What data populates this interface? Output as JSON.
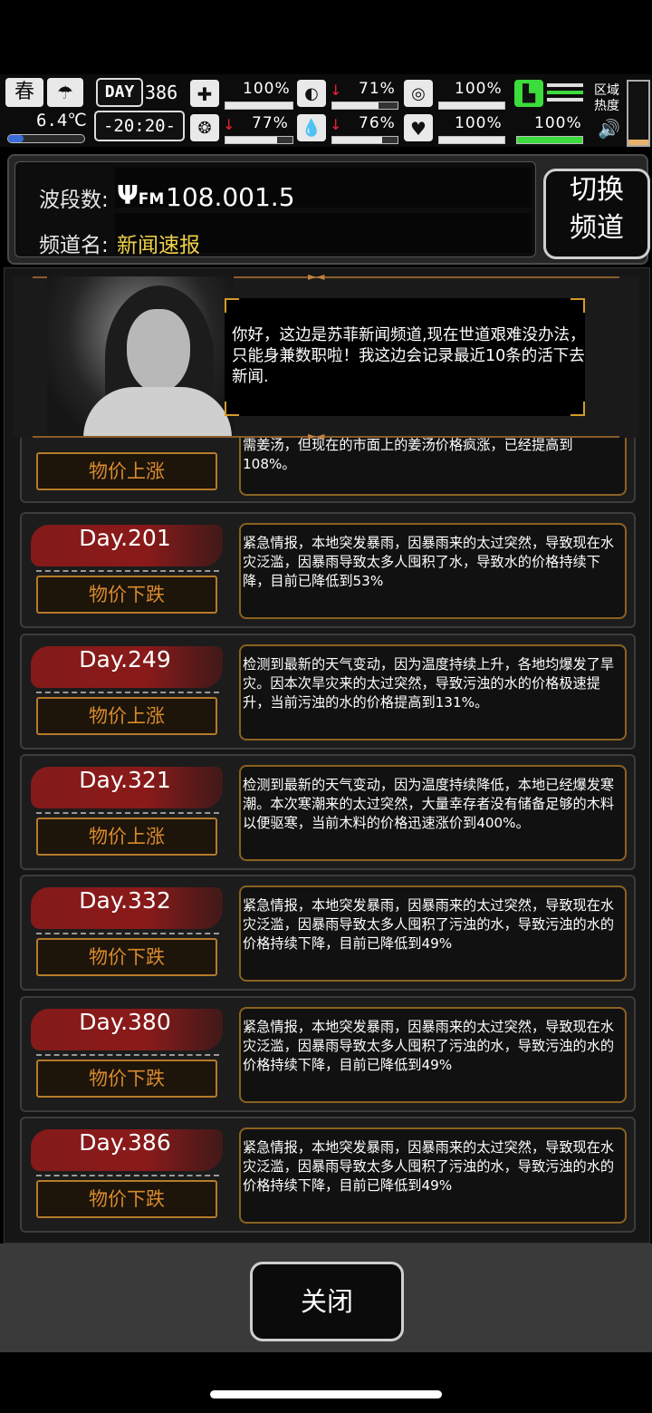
{
  "hud": {
    "season": "春",
    "temperature": "6.4℃",
    "day_label": "DAY",
    "day_number": "386",
    "clock": "-20:20-",
    "stats": [
      {
        "name": "health",
        "value": "100%",
        "level": 1.0
      },
      {
        "name": "hunger",
        "value": "71%",
        "level": 0.71
      },
      {
        "name": "hygiene",
        "value": "100%",
        "level": 1.0
      },
      {
        "name": "mind",
        "value": "77%",
        "level": 0.77
      },
      {
        "name": "thirst",
        "value": "76%",
        "level": 0.76
      },
      {
        "name": "mood",
        "value": "100%",
        "level": 1.0
      },
      {
        "name": "stamina",
        "value": "100%",
        "level": 1.0
      }
    ],
    "region_heat": "区域\n热度"
  },
  "radio": {
    "band_label": "波段数:",
    "frequency": "108.001.5",
    "fm": "FM",
    "channel_label": "频道名:",
    "channel_name": "新闻速报",
    "switch_button_line1": "切换",
    "switch_button_line2": "频道"
  },
  "anchor": {
    "speech": "你好，这边是苏菲新闻频道,现在世道艰难没办法，只能身兼数职啦！我这边会记录最近10条的活下去新闻."
  },
  "partial_news": {
    "tag": "物价上涨",
    "text": "需姜汤，但现在的市面上的姜汤价格疯涨，已经提高到108%。"
  },
  "news": [
    {
      "day": "Day.201",
      "tag": "物价下跌",
      "text": "紧急情报，本地突发暴雨，因暴雨来的太过突然，导致现在水灾泛滥，因暴雨导致太多人囤积了水，导致水的价格持续下降，目前已降低到53%"
    },
    {
      "day": "Day.249",
      "tag": "物价上涨",
      "text": "检测到最新的天气变动，因为温度持续上升，各地均爆发了旱灾。因本次旱灾来的太过突然，导致污浊的水的价格极速提升，当前污浊的水的价格提高到131%。"
    },
    {
      "day": "Day.321",
      "tag": "物价上涨",
      "text": "检测到最新的天气变动，因为温度持续降低，本地已经爆发寒潮。本次寒潮来的太过突然，大量幸存者没有储备足够的木料以便驱寒，当前木料的价格迅速涨价到400%。"
    },
    {
      "day": "Day.332",
      "tag": "物价下跌",
      "text": "紧急情报，本地突发暴雨，因暴雨来的太过突然，导致现在水灾泛滥，因暴雨导致太多人囤积了污浊的水，导致污浊的水的价格持续下降，目前已降低到49%"
    },
    {
      "day": "Day.380",
      "tag": "物价下跌",
      "text": "紧急情报，本地突发暴雨，因暴雨来的太过突然，导致现在水灾泛滥，因暴雨导致太多人囤积了污浊的水，导致污浊的水的价格持续下降，目前已降低到49%"
    },
    {
      "day": "Day.386",
      "tag": "物价下跌",
      "text": "紧急情报，本地突发暴雨，因暴雨来的太过突然，导致现在水灾泛滥，因暴雨导致太多人囤积了污浊的水，导致污浊的水的价格持续下降，目前已降低到49%"
    }
  ],
  "footer": {
    "close_label": "关闭"
  }
}
